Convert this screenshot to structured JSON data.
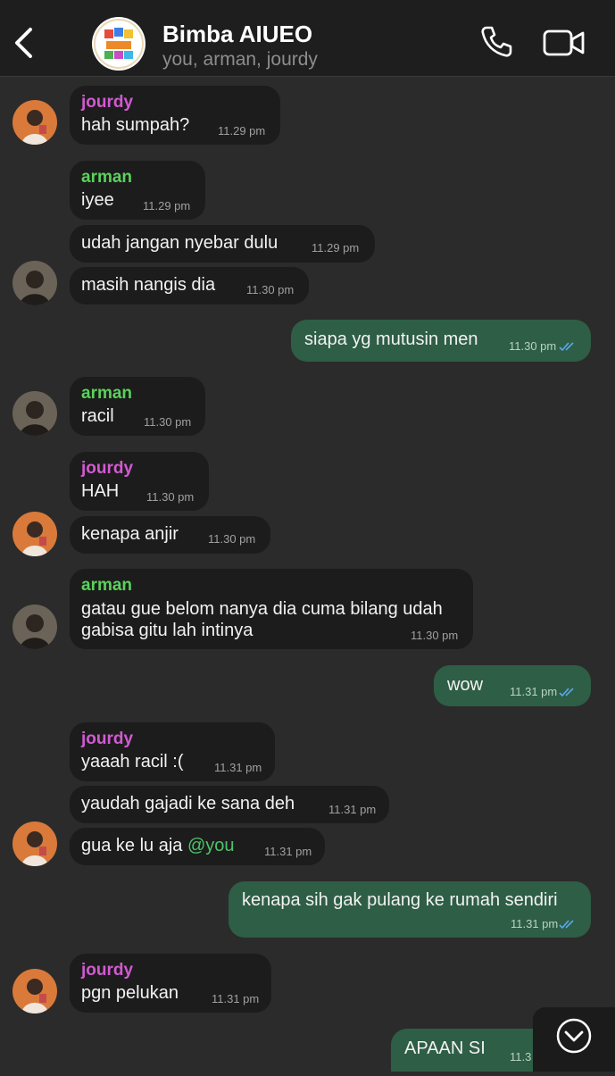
{
  "header": {
    "title": "Bimba AIUEO",
    "subtitle": "you, arman, jourdy",
    "back_icon": "chevron-left-icon",
    "call_icon": "phone-icon",
    "video_icon": "video-camera-icon"
  },
  "colors": {
    "background": "#2b2b2b",
    "incoming_bubble": "#1c1c1c",
    "outgoing_bubble": "#2e5e45",
    "jourdy": "#d25ad2",
    "arman": "#5ad25a",
    "read_ticks": "#5aa7e8"
  },
  "messages": [
    {
      "sender": "jourdy",
      "text": "hah sumpah?",
      "time": "11.29 pm"
    },
    {
      "sender": "arman",
      "text": "iyee",
      "time": "11.29 pm"
    },
    {
      "text": "udah jangan nyebar dulu",
      "time": "11.29 pm"
    },
    {
      "text": "masih nangis dia",
      "time": "11.30 pm"
    },
    {
      "text": "siapa yg mutusin men",
      "time": "11.30 pm"
    },
    {
      "sender": "arman",
      "text": "racil",
      "time": "11.30 pm"
    },
    {
      "sender": "jourdy",
      "text": "HAH",
      "time": "11.30 pm"
    },
    {
      "text": "kenapa anjir",
      "time": "11.30 pm"
    },
    {
      "sender": "arman",
      "text_line1": "gatau gue belom nanya dia cuma bilang udah",
      "text_line2": "gabisa gitu lah intinya",
      "time": "11.30 pm"
    },
    {
      "text": "wow",
      "time": "11.31 pm"
    },
    {
      "sender": "jourdy",
      "text": "yaaah racil :(",
      "time": "11.31 pm"
    },
    {
      "text": "yaudah gajadi ke sana deh",
      "time": "11.31 pm"
    },
    {
      "text": "gua ke lu aja ",
      "mention": "@you",
      "time": "11.31 pm"
    },
    {
      "text": "kenapa sih gak pulang ke rumah sendiri",
      "time": "11.31 pm"
    },
    {
      "sender": "jourdy",
      "text": "pgn pelukan",
      "time": "11.31 pm"
    },
    {
      "text": "APAAN SI",
      "time": "11.3"
    }
  ],
  "scroll_button_icon": "chevron-down-circle-icon"
}
